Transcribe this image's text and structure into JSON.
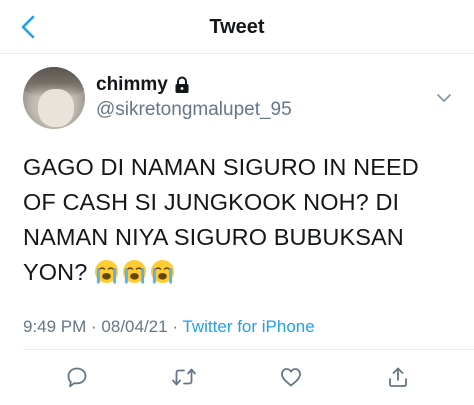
{
  "header": {
    "title": "Tweet",
    "back_icon": "chevron-left-icon",
    "accent_color": "#1da1f2"
  },
  "tweet": {
    "author": {
      "display_name": "chimmy",
      "handle": "@sikretongmalupet_95",
      "protected_icon": "lock-icon"
    },
    "text_lines": [
      "GAGO DI NAMAN SIGURO IN NEED",
      "OF CASH SI JUNGKOOK NOH? DI",
      "NAMAN NIYA SIGURO BUBUKSAN",
      "YON?"
    ],
    "emojis": [
      "😭",
      "😭",
      "😭"
    ],
    "time": "9:49 PM",
    "separator": " · ",
    "date": "08/04/21",
    "source": "Twitter for iPhone"
  },
  "actions": {
    "reply": "reply-icon",
    "retweet": "retweet-icon",
    "like": "like-icon",
    "share": "share-icon"
  }
}
